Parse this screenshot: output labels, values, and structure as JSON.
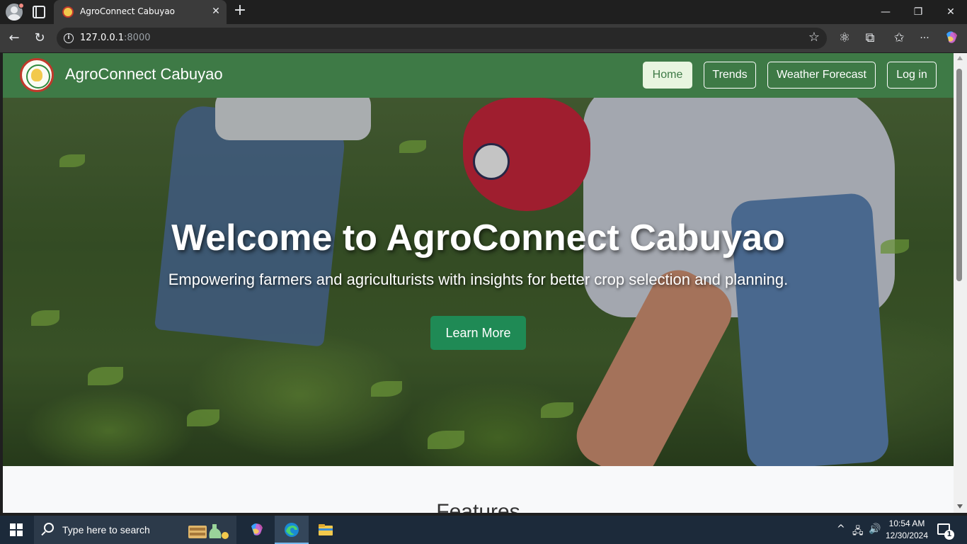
{
  "browser": {
    "tab_title": "AgroConnect Cabuyao",
    "tab_close_glyph": "✕",
    "new_tab_glyph": "+",
    "window_controls": {
      "minimize": "—",
      "restore": "❐",
      "close": "✕"
    },
    "url_host": "127.0.0.1",
    "url_port": ":8000",
    "toolbar_icons": [
      "back-icon",
      "refresh-icon",
      "site-info-icon",
      "favorite-star-icon",
      "extension-icon",
      "puzzle-icon",
      "favorites-icon",
      "more-icon",
      "copilot-icon"
    ],
    "glyphs": {
      "back": "←",
      "refresh": "↻",
      "info": "i",
      "star": "☆",
      "atom": "⚛",
      "puzzle": "⧉",
      "favorites": "✩",
      "more": "···"
    }
  },
  "site": {
    "brand": "AgroConnect Cabuyao",
    "nav": [
      {
        "label": "Home",
        "active": true
      },
      {
        "label": "Trends",
        "active": false
      },
      {
        "label": "Weather Forecast",
        "active": false
      },
      {
        "label": "Log in",
        "active": false
      }
    ],
    "hero": {
      "title": "Welcome to AgroConnect Cabuyao",
      "subtitle": "Empowering farmers and agriculturists with insights for better crop selection and planning.",
      "cta": "Learn More"
    },
    "features_heading": "Features"
  },
  "taskbar": {
    "search_placeholder": "Type here to search",
    "apps": [
      "copilot-icon",
      "edge-icon",
      "file-explorer-icon"
    ],
    "tray": {
      "chevron": "^",
      "network": "🖧",
      "volume": "🔊"
    },
    "time": "10:54 AM",
    "date": "12/30/2024",
    "notification_count": "1"
  },
  "colors": {
    "navbar": "#3e7a46",
    "active_nav_bg": "#e8f5e0",
    "cta": "#1f8a55",
    "chrome_dark": "#1f1f1f",
    "taskbar": "#1c2a3a"
  }
}
